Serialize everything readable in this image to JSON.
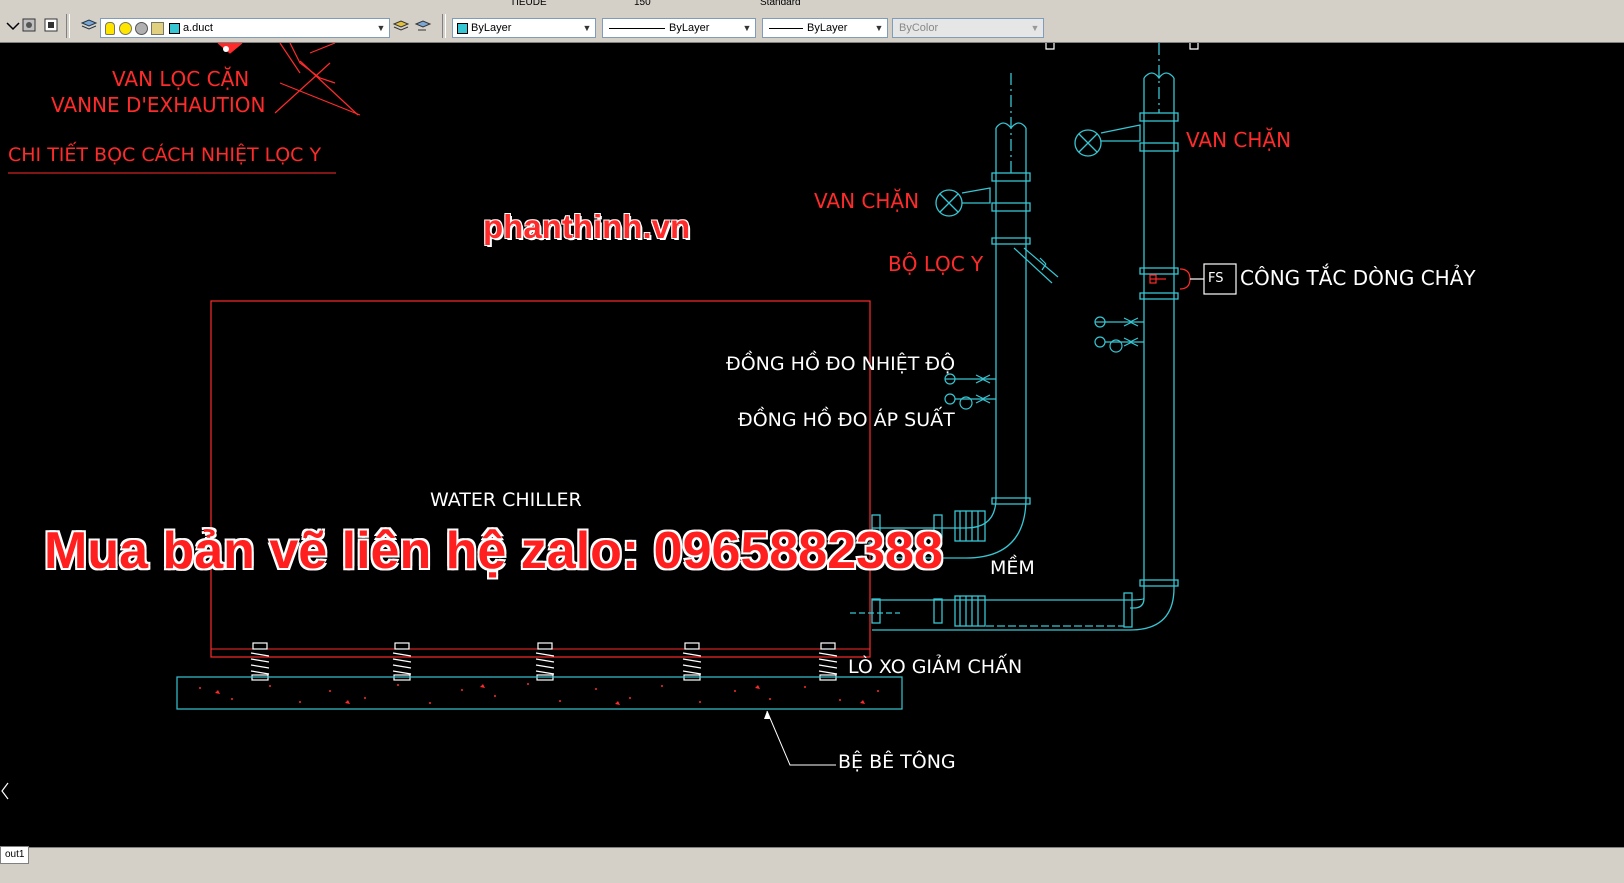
{
  "colors": {
    "canvas": "#000000",
    "cyan": "#36c6d3",
    "red": "#ff2a2a",
    "white": "#ffffff",
    "toolbar": "#d4d0c8"
  },
  "toolbar_top": {
    "text_style": "TIEUDE",
    "dim_style": "150",
    "table_style": "Standard"
  },
  "toolbar": {
    "layer_name": "a.duct",
    "color_control": "ByLayer",
    "linetype_control": "ByLayer",
    "lineweight_control": "ByLayer",
    "plotstyle_control": "ByColor"
  },
  "drawing": {
    "valve_label_vn": "VAN LỌC CẶN",
    "valve_label_fr": "VANNE D'EXHAUTION",
    "detail_title": "CHI TIẾT BỌC  CÁCH NHIỆT LỌC Y",
    "watermark_site": "phanthinh.vn",
    "watermark_contact": "Mua bản vẽ liên hệ zalo: 0965882388",
    "van_chan_right": "VAN CHẶN",
    "van_chan_left": "VAN CHẶN",
    "y_filter": "BỘ LỌC Y",
    "flow_switch_tag": "FS",
    "flow_switch": "CÔNG TẮC DÒNG CHẢY",
    "thermometer": "ĐỒNG HỒ ĐO NHIỆT ĐỘ",
    "pressure_gauge": "ĐỒNG HỒ ĐO ÁP SUẤT",
    "chiller": "WATER CHILLER",
    "flex_joint_partial": "MỀM",
    "spring_isolator": "LÒ XO GIẢM CHẤN",
    "concrete_base": "BỆ BÊ TÔNG"
  },
  "statusbar": {
    "layout_tab": "out1"
  }
}
